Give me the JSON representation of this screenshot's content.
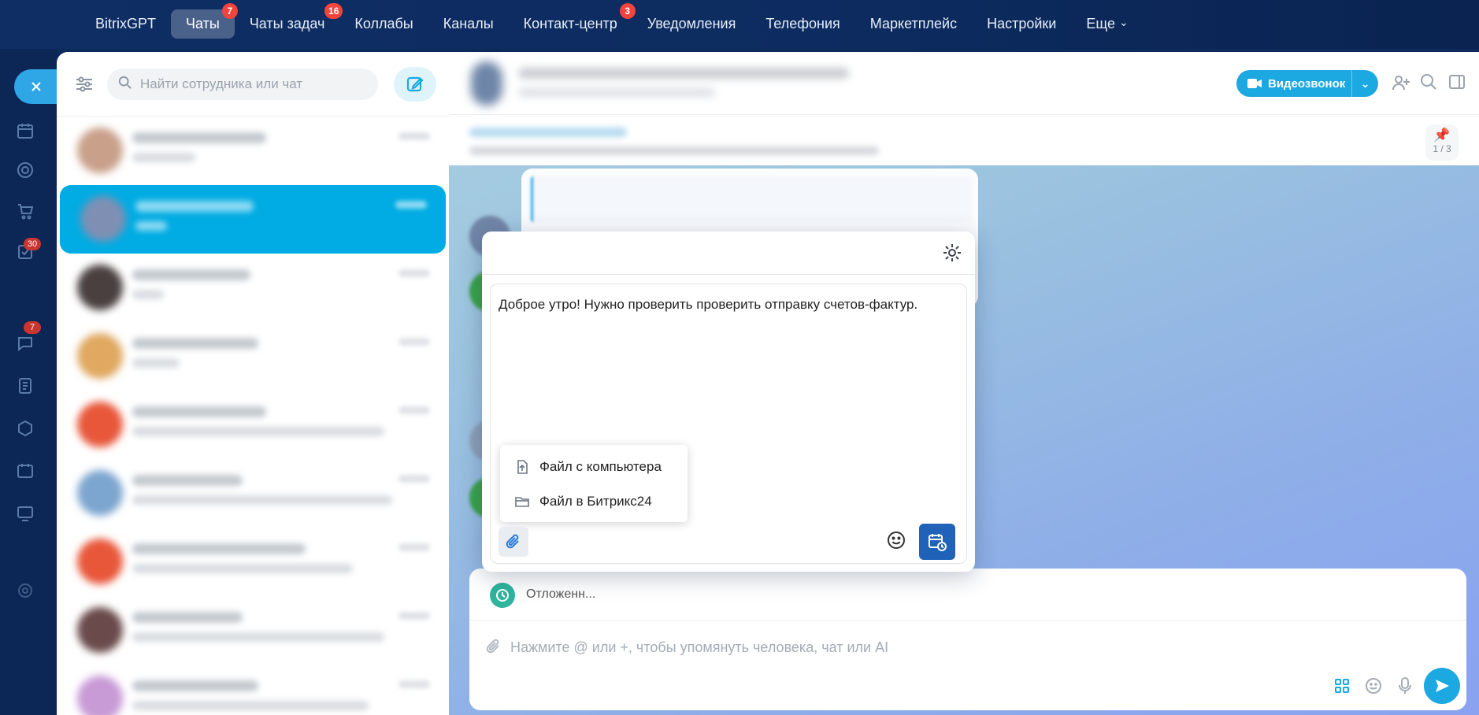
{
  "nav": {
    "items": [
      {
        "label": "BitrixGPT",
        "badge": ""
      },
      {
        "label": "Чаты",
        "badge": "7",
        "active": true
      },
      {
        "label": "Чаты задач",
        "badge": "16"
      },
      {
        "label": "Коллабы",
        "badge": ""
      },
      {
        "label": "Каналы",
        "badge": ""
      },
      {
        "label": "Контакт-центр",
        "badge": "3"
      },
      {
        "label": "Уведомления",
        "badge": ""
      },
      {
        "label": "Телефония",
        "badge": ""
      },
      {
        "label": "Маркетплейс",
        "badge": ""
      },
      {
        "label": "Настройки",
        "badge": ""
      },
      {
        "label": "Еще",
        "badge": ""
      }
    ]
  },
  "rail": {
    "badges": [
      "30",
      "7"
    ]
  },
  "sidebar": {
    "search_placeholder": "Найти сотрудника или чат"
  },
  "chat": {
    "video_button_label": "Видеозвонок",
    "pinned_counter": "1 / 3"
  },
  "popup": {
    "message_text": "Доброе утро! Нужно проверить проверить отправку счетов-фактур.",
    "attach_menu": {
      "from_computer": "Файл с компьютера",
      "from_bitrix24": "Файл в Битрикс24"
    }
  },
  "composer": {
    "scheduled_label": "Отложенн...",
    "placeholder": "Нажмите @ или +, чтобы упомянуть человека, чат или AI"
  },
  "colors": {
    "accent": "#1ca8e0",
    "active_chat": "#00ace3",
    "schedule_button": "#1f62b7",
    "badge": "#f0443c"
  }
}
